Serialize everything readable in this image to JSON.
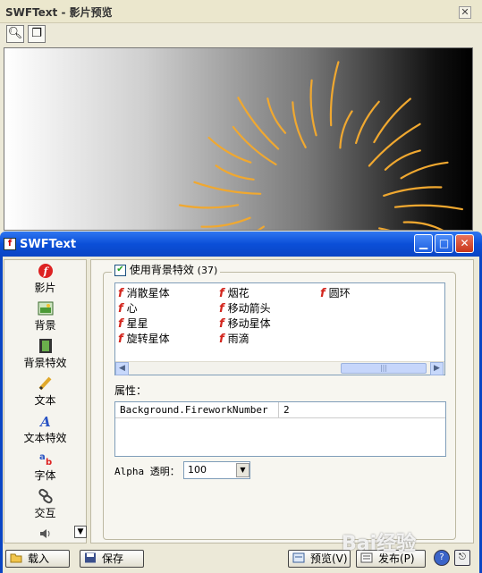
{
  "preview_window": {
    "title": "SWFText - 影片预览",
    "close_label": "✕"
  },
  "main_window": {
    "title": "SWFText",
    "icon_glyph": "f"
  },
  "nav": {
    "items": [
      {
        "label": "影片",
        "icon": "movie-icon",
        "glyph": "ƒ",
        "color": "#d22"
      },
      {
        "label": "背景",
        "icon": "image-icon",
        "glyph": "▣",
        "color": "#3a8a2e"
      },
      {
        "label": "背景特效",
        "icon": "film-icon",
        "glyph": "▦",
        "color": "#3a8a2e"
      },
      {
        "label": "文本",
        "icon": "pencil-icon",
        "glyph": "✎",
        "color": "#c08a10"
      },
      {
        "label": "文本特效",
        "icon": "text-effect-icon",
        "glyph": "A",
        "color": "#2a54c4"
      },
      {
        "label": "字体",
        "icon": "font-icon",
        "glyph": "a",
        "color": "#2a54c4"
      },
      {
        "label": "交互",
        "icon": "link-icon",
        "glyph": "⚭",
        "color": "#444"
      }
    ],
    "sound_glyph": "◁)"
  },
  "effects": {
    "checkbox_label": "使用背景特效",
    "count": "(37)",
    "checked": true,
    "columns": [
      [
        "消散星体",
        "心",
        "星星",
        "旋转星体"
      ],
      [
        "烟花",
        "移动箭头",
        "移动星体",
        "雨滴"
      ],
      [
        "圆环"
      ]
    ],
    "icon_glyph": "f"
  },
  "properties": {
    "label": "属性：",
    "rows": [
      {
        "key": "Background.FireworkNumber",
        "value": "2"
      }
    ]
  },
  "alpha": {
    "label": "Alpha 透明：",
    "value": "100"
  },
  "bottom": {
    "load_label": "载入",
    "save_label": "保存",
    "preview_label": "预览(V)",
    "publish_label": "发布(P)"
  },
  "watermark": "Bai经验",
  "colors": {
    "title_blue": "#0b4fd8",
    "firework": "#f0a830",
    "effect_icon": "#d3261e"
  }
}
